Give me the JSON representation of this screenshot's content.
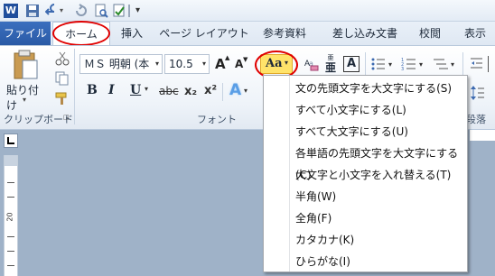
{
  "qat": {
    "app_icon_label": "W"
  },
  "tabs": [
    {
      "label": "ファイル"
    },
    {
      "label": "ホーム"
    },
    {
      "label": "挿入"
    },
    {
      "label": "ページ レイアウト"
    },
    {
      "label": "参考資料"
    },
    {
      "label": "差し込み文書"
    },
    {
      "label": "校閲"
    },
    {
      "label": "表示"
    }
  ],
  "ribbon": {
    "paste_label": "貼り付け",
    "clipboard_group": "クリップボード",
    "font_group": "フォント",
    "paragraph_group_partial": "段落",
    "font_name": "ＭＳ 明朝 (本",
    "font_size": "10.5",
    "change_case_label": "Aa",
    "grow_font": "A",
    "shrink_font": "A",
    "bold": "B",
    "italic": "I",
    "underline": "U",
    "strike": "abc",
    "subscript": "x₂",
    "superscript": "x²",
    "text_effects": "A",
    "char_border": "A",
    "phonetic_top": "亜",
    "phonetic_bottom": "亜"
  },
  "ruler": {
    "mark_20": "20"
  },
  "menu": {
    "items": [
      {
        "label": "文の先頭文字を大文字にする(S)"
      },
      {
        "label": "すべて小文字にする(L)"
      },
      {
        "label": "すべて大文字にする(U)"
      },
      {
        "label": "各単語の先頭文字を大文字にする(C)"
      },
      {
        "label": "大文字と小文字を入れ替える(T)"
      },
      {
        "label": "半角(W)"
      },
      {
        "label": "全角(F)"
      },
      {
        "label": "カタカナ(K)"
      },
      {
        "label": "ひらがな(I)"
      }
    ]
  },
  "colors": {
    "callout": "#e00000",
    "file_tab": "#2a5aa6",
    "highlight_button": "#ffe36a"
  }
}
